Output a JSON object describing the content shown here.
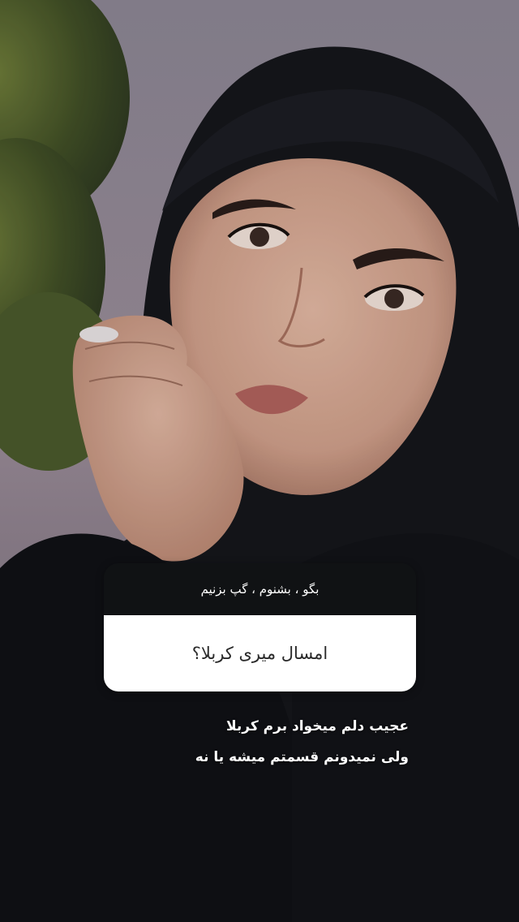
{
  "question_sticker": {
    "header_text": "بگو ، بشنوم ، گپ بزنیم",
    "question_text": "امسال میری کربلا؟"
  },
  "reply": {
    "lines": [
      "عجیب دلم میخواد برم کربلا",
      "ولی نمیدونم قسمتم میشه یا نه"
    ]
  },
  "colors": {
    "sky": "#8f8290",
    "hijab": "#121318",
    "skin": "#d8ab96",
    "card_header": "#101214",
    "card_body": "#ffffff"
  }
}
